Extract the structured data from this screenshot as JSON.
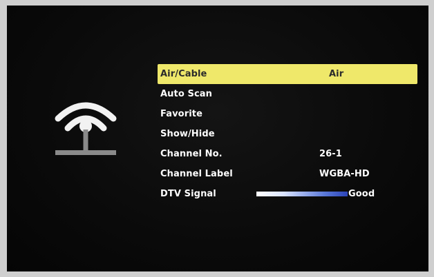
{
  "menu": {
    "items": [
      {
        "label": "Air/Cable",
        "value": "Air"
      },
      {
        "label": "Auto Scan",
        "value": ""
      },
      {
        "label": "Favorite",
        "value": ""
      },
      {
        "label": "Show/Hide",
        "value": ""
      },
      {
        "label": "Channel No.",
        "value": "26-1"
      },
      {
        "label": "Channel Label",
        "value": "WGBA-HD"
      },
      {
        "label": "DTV Signal",
        "value": "Good",
        "signal_level": 1.0
      }
    ]
  },
  "icons": {
    "category": "antenna-signal-icon"
  },
  "colors": {
    "highlight": "#efe86a",
    "signal_bar": "#2b44b8",
    "text": "#ffffff",
    "background": "#0a0a0a"
  }
}
